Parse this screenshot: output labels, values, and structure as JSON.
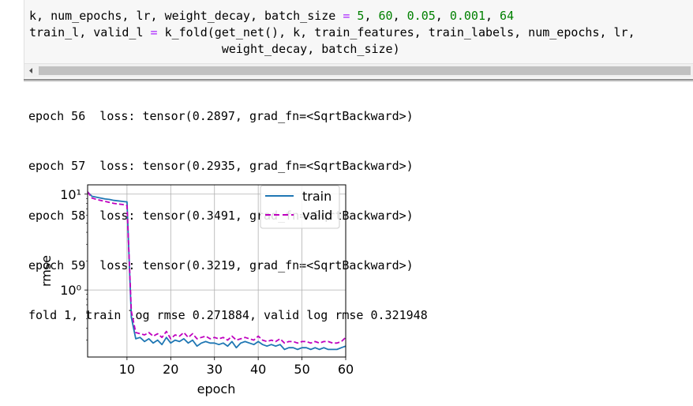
{
  "code_cell": {
    "lines": [
      [
        {
          "t": "k, num_epochs, lr, weight_decay, batch_size ",
          "c": ""
        },
        {
          "t": "=",
          "c": "op"
        },
        {
          "t": " ",
          "c": ""
        },
        {
          "t": "5",
          "c": "num"
        },
        {
          "t": ", ",
          "c": ""
        },
        {
          "t": "60",
          "c": "num"
        },
        {
          "t": ", ",
          "c": ""
        },
        {
          "t": "0.05",
          "c": "num"
        },
        {
          "t": ", ",
          "c": ""
        },
        {
          "t": "0.001",
          "c": "num"
        },
        {
          "t": ", ",
          "c": ""
        },
        {
          "t": "64",
          "c": "num"
        }
      ],
      [
        {
          "t": "train_l, valid_l ",
          "c": ""
        },
        {
          "t": "=",
          "c": "op"
        },
        {
          "t": " k_fold(get_net(), k, train_features, train_labels, num_epochs, lr,",
          "c": ""
        }
      ],
      [
        {
          "t": "                           weight_decay, batch_size)",
          "c": ""
        }
      ]
    ],
    "scroll_left_icon": "triangle-left-icon"
  },
  "output": {
    "lines": [
      "epoch 56  loss: tensor(0.2897, grad_fn=<SqrtBackward>)",
      "epoch 57  loss: tensor(0.2935, grad_fn=<SqrtBackward>)",
      "epoch 58  loss: tensor(0.3491, grad_fn=<SqrtBackward>)",
      "epoch 59  loss: tensor(0.3219, grad_fn=<SqrtBackward>)",
      "fold 1, train log rmse 0.271884, valid log rmse 0.321948"
    ]
  },
  "chart_data": {
    "type": "line",
    "xlabel": "epoch",
    "ylabel": "rmse",
    "yscale": "log",
    "xlim": [
      1,
      60
    ],
    "ylim": [
      0.2,
      12.5
    ],
    "xticks": [
      10,
      20,
      30,
      40,
      50,
      60
    ],
    "yticks": [
      {
        "value": 1,
        "label": "10⁰"
      },
      {
        "value": 10,
        "label": "10¹"
      }
    ],
    "grid": true,
    "legend": "top-right",
    "series": [
      {
        "name": "train",
        "color": "#1f77b4",
        "style": "solid",
        "x": [
          1,
          2,
          3,
          4,
          5,
          6,
          7,
          8,
          9,
          10,
          11,
          12,
          13,
          14,
          15,
          16,
          17,
          18,
          19,
          20,
          21,
          22,
          23,
          24,
          25,
          26,
          27,
          28,
          29,
          30,
          31,
          32,
          33,
          34,
          35,
          36,
          37,
          38,
          39,
          40,
          41,
          42,
          43,
          44,
          45,
          46,
          47,
          48,
          49,
          50,
          51,
          52,
          53,
          54,
          55,
          56,
          57,
          58,
          59,
          60
        ],
        "values": [
          10.5,
          9.5,
          9.3,
          9.1,
          8.9,
          8.8,
          8.6,
          8.5,
          8.4,
          8.3,
          0.52,
          0.31,
          0.32,
          0.29,
          0.31,
          0.28,
          0.3,
          0.27,
          0.32,
          0.28,
          0.3,
          0.29,
          0.31,
          0.28,
          0.3,
          0.26,
          0.28,
          0.29,
          0.28,
          0.28,
          0.27,
          0.28,
          0.26,
          0.29,
          0.25,
          0.28,
          0.29,
          0.28,
          0.27,
          0.29,
          0.27,
          0.26,
          0.27,
          0.26,
          0.27,
          0.24,
          0.25,
          0.25,
          0.24,
          0.25,
          0.25,
          0.24,
          0.25,
          0.24,
          0.25,
          0.24,
          0.24,
          0.24,
          0.25,
          0.26
        ]
      },
      {
        "name": "valid",
        "color": "#bf00bf",
        "style": "dashed",
        "x": [
          1,
          2,
          3,
          4,
          5,
          6,
          7,
          8,
          9,
          10,
          11,
          12,
          13,
          14,
          15,
          16,
          17,
          18,
          19,
          20,
          21,
          22,
          23,
          24,
          25,
          26,
          27,
          28,
          29,
          30,
          31,
          32,
          33,
          34,
          35,
          36,
          37,
          38,
          39,
          40,
          41,
          42,
          43,
          44,
          45,
          46,
          47,
          48,
          49,
          50,
          51,
          52,
          53,
          54,
          55,
          56,
          57,
          58,
          59,
          60
        ],
        "values": [
          10.6,
          9.1,
          8.8,
          8.6,
          8.4,
          8.2,
          8.0,
          7.9,
          7.8,
          7.6,
          0.6,
          0.36,
          0.35,
          0.34,
          0.36,
          0.33,
          0.35,
          0.32,
          0.37,
          0.31,
          0.34,
          0.33,
          0.36,
          0.32,
          0.35,
          0.31,
          0.32,
          0.33,
          0.31,
          0.32,
          0.31,
          0.32,
          0.3,
          0.33,
          0.3,
          0.31,
          0.32,
          0.31,
          0.3,
          0.33,
          0.3,
          0.29,
          0.3,
          0.29,
          0.31,
          0.28,
          0.29,
          0.29,
          0.28,
          0.29,
          0.29,
          0.28,
          0.29,
          0.28,
          0.29,
          0.29,
          0.28,
          0.28,
          0.29,
          0.32
        ]
      }
    ]
  }
}
